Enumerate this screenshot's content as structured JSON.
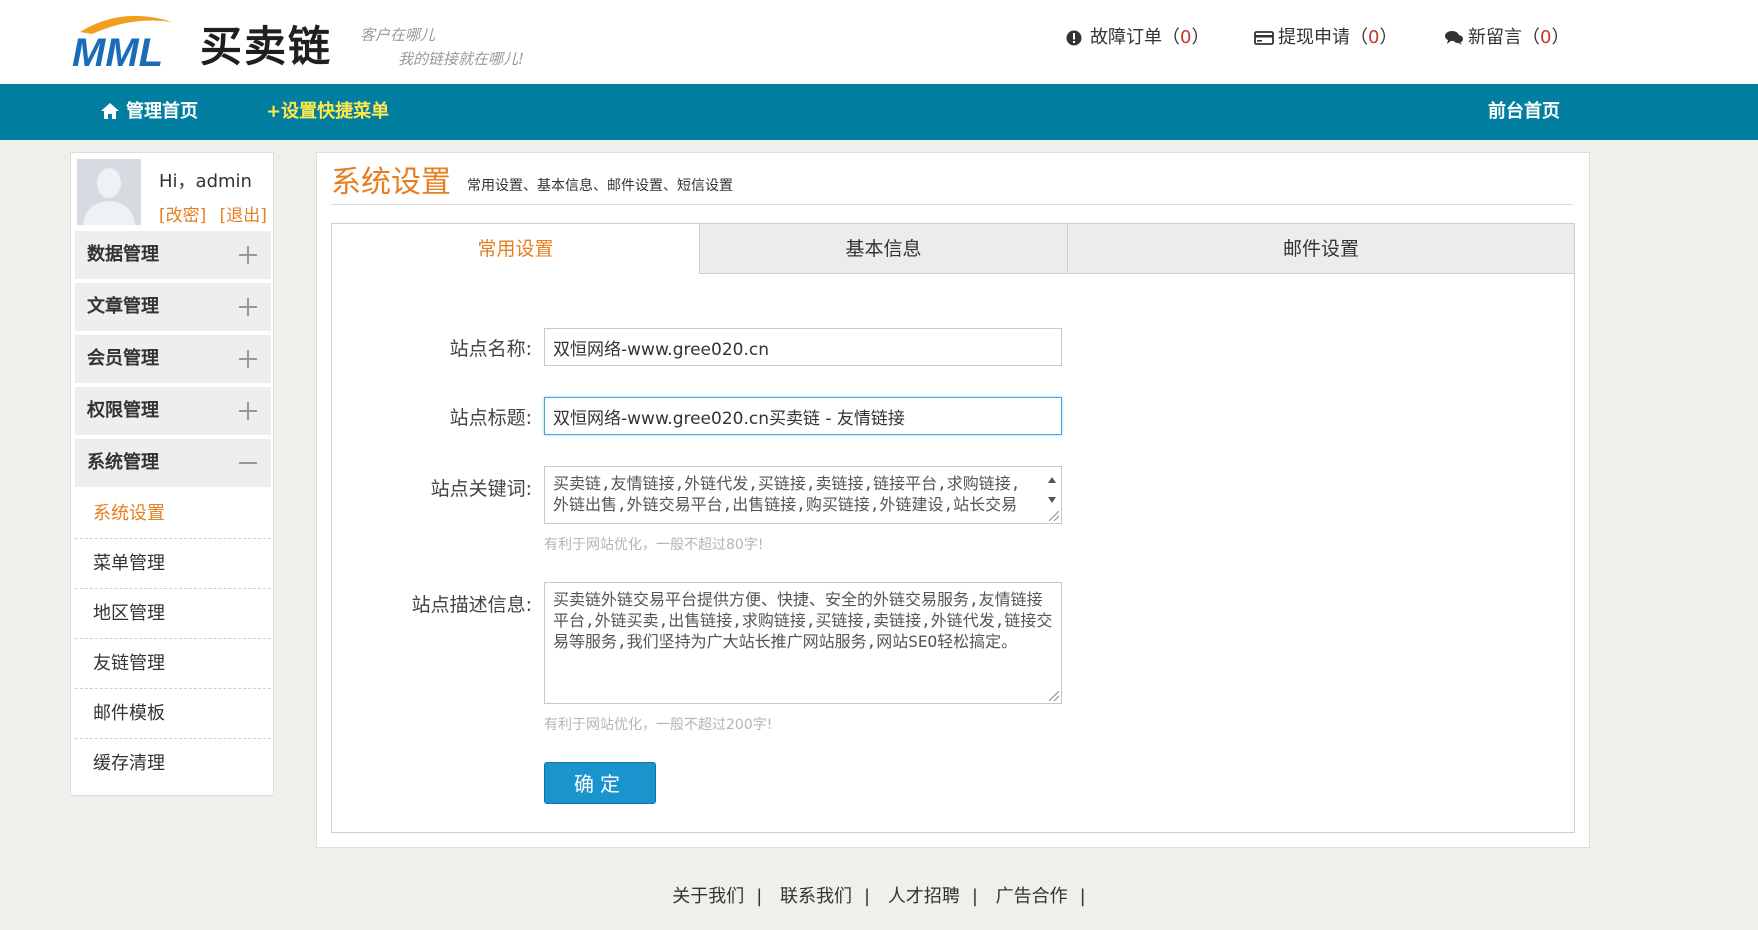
{
  "header": {
    "logo_text": "买卖链",
    "logo_mark": "MML",
    "slogan_line1": "客户在哪儿",
    "slogan_line2": "我的链接就在哪儿!",
    "links": [
      {
        "label": "故障订单",
        "count": "0",
        "icon": "alert-circle-icon"
      },
      {
        "label": "提现申请",
        "count": "0",
        "icon": "card-icon"
      },
      {
        "label": "新留言",
        "count": "0",
        "icon": "chat-bubbles-icon"
      }
    ]
  },
  "nav": {
    "home": "管理首页",
    "shortcut": "+设置快捷菜单",
    "frontend": "前台首页"
  },
  "sidebar": {
    "greeting": "Hi，admin",
    "change_link": "[改密]",
    "logout_link": "[退出]",
    "groups": [
      {
        "label": "数据管理",
        "expanded": false
      },
      {
        "label": "文章管理",
        "expanded": false
      },
      {
        "label": "会员管理",
        "expanded": false
      },
      {
        "label": "权限管理",
        "expanded": false
      },
      {
        "label": "系统管理",
        "expanded": true
      }
    ],
    "sub_items": [
      {
        "label": "系统设置",
        "active": true
      },
      {
        "label": "菜单管理",
        "active": false
      },
      {
        "label": "地区管理",
        "active": false
      },
      {
        "label": "友链管理",
        "active": false
      },
      {
        "label": "邮件模板",
        "active": false
      },
      {
        "label": "缓存清理",
        "active": false
      }
    ]
  },
  "main": {
    "title": "系统设置",
    "subtitle": "常用设置、基本信息、邮件设置、短信设置",
    "tabs": [
      {
        "label": "常用设置",
        "active": true
      },
      {
        "label": "基本信息",
        "active": false
      },
      {
        "label": "邮件设置",
        "active": false
      }
    ],
    "form": {
      "site_name_label": "站点名称:",
      "site_name_value": "双恒网络-www.gree020.cn",
      "site_title_label": "站点标题:",
      "site_title_value": "双恒网络-www.gree020.cn买卖链 - 友情链接",
      "keywords_label": "站点关键词:",
      "keywords_value": "买卖链,友情链接,外链代发,买链接,卖链接,链接平台,求购链接,外链出售,外链交易平台,出售链接,购买链接,外链建设,站长交易",
      "keywords_hint": "有利于网站优化，一般不超过80字!",
      "desc_label": "站点描述信息:",
      "desc_value": "买卖链外链交易平台提供方便、快捷、安全的外链交易服务,友情链接平台,外链买卖,出售链接,求购链接,买链接,卖链接,外链代发,链接交易等服务,我们坚持为广大站长推广网站服务,网站SEO轻松搞定。",
      "desc_hint": "有利于网站优化，一般不超过200字!",
      "submit": "确定"
    }
  },
  "footer": {
    "links": [
      "关于我们",
      "联系我们",
      "人才招聘",
      "广告合作"
    ],
    "separator": "|"
  },
  "colors": {
    "nav_bg": "#017ea0",
    "accent": "#e67e22",
    "shortcut": "#ffe84d",
    "button": "#1a94cc",
    "count": "#c0392b"
  }
}
